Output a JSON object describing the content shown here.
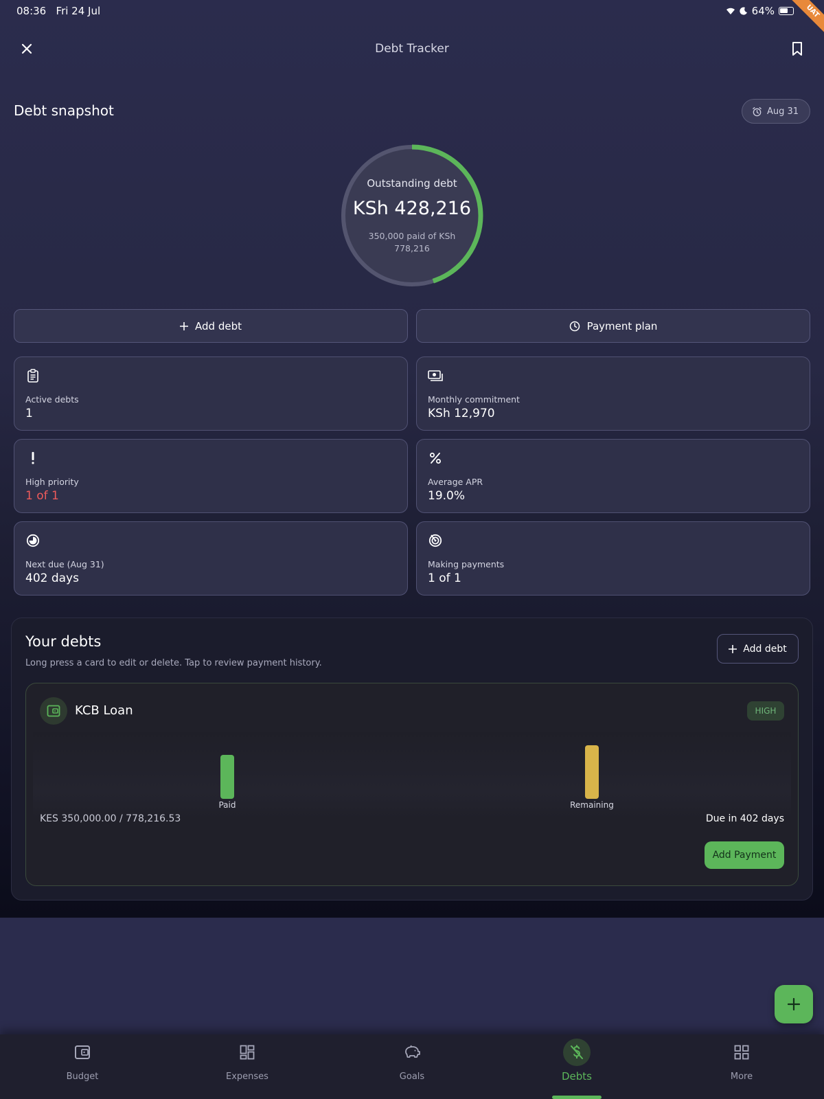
{
  "status_bar": {
    "time": "08:36",
    "date": "Fri 24 Jul",
    "battery": "64%",
    "env_ribbon": "UAT"
  },
  "header": {
    "title": "Debt Tracker"
  },
  "snapshot": {
    "title": "Debt snapshot",
    "date_chip": "Aug 31",
    "gauge": {
      "label": "Outstanding debt",
      "amount": "KSh 428,216",
      "subtext": "350,000 paid of KSh 778,216",
      "paid_fraction": 0.45
    }
  },
  "actions": {
    "add_debt": "Add debt",
    "payment_plan": "Payment plan"
  },
  "stats": {
    "active_debts": {
      "label": "Active debts",
      "value": "1",
      "icon": "clipboard-icon"
    },
    "monthly_commitment": {
      "label": "Monthly commitment",
      "value": "KSh 12,970",
      "icon": "cash-icon"
    },
    "high_priority": {
      "label": "High priority",
      "value": "1 of 1",
      "icon": "exclamation-icon"
    },
    "average_apr": {
      "label": "Average APR",
      "value": "19.0%",
      "icon": "percent-icon"
    },
    "next_due": {
      "label": "Next due (Aug 31)",
      "value": "402 days",
      "icon": "timelapse-icon"
    },
    "making_payments": {
      "label": "Making payments",
      "value": "1 of 1",
      "icon": "target-icon"
    }
  },
  "your_debts": {
    "title": "Your debts",
    "hint": "Long press a card to edit or delete. Tap to review payment history.",
    "add_label": "Add debt",
    "debts": [
      {
        "name": "KCB Loan",
        "priority": "HIGH",
        "amounts": "KES 350,000.00 / 778,216.53",
        "due": "Due in 402 days",
        "add_payment": "Add Payment",
        "chart_data": {
          "type": "bar",
          "categories": [
            "Paid",
            "Remaining"
          ],
          "values": [
            350000.0,
            428216.53
          ],
          "colors": [
            "#5cb65a",
            "#d8b44a"
          ]
        }
      }
    ]
  },
  "nav": {
    "items": [
      {
        "label": "Budget",
        "icon": "wallet-icon",
        "active": false
      },
      {
        "label": "Expenses",
        "icon": "dashboard-icon",
        "active": false
      },
      {
        "label": "Goals",
        "icon": "piggy-bank-icon",
        "active": false
      },
      {
        "label": "Debts",
        "icon": "money-off-icon",
        "active": true
      },
      {
        "label": "More",
        "icon": "grid-icon",
        "active": false
      }
    ]
  },
  "colors": {
    "accent": "#5cb65a",
    "danger": "#ef5b5b",
    "warning": "#d8b44a"
  }
}
